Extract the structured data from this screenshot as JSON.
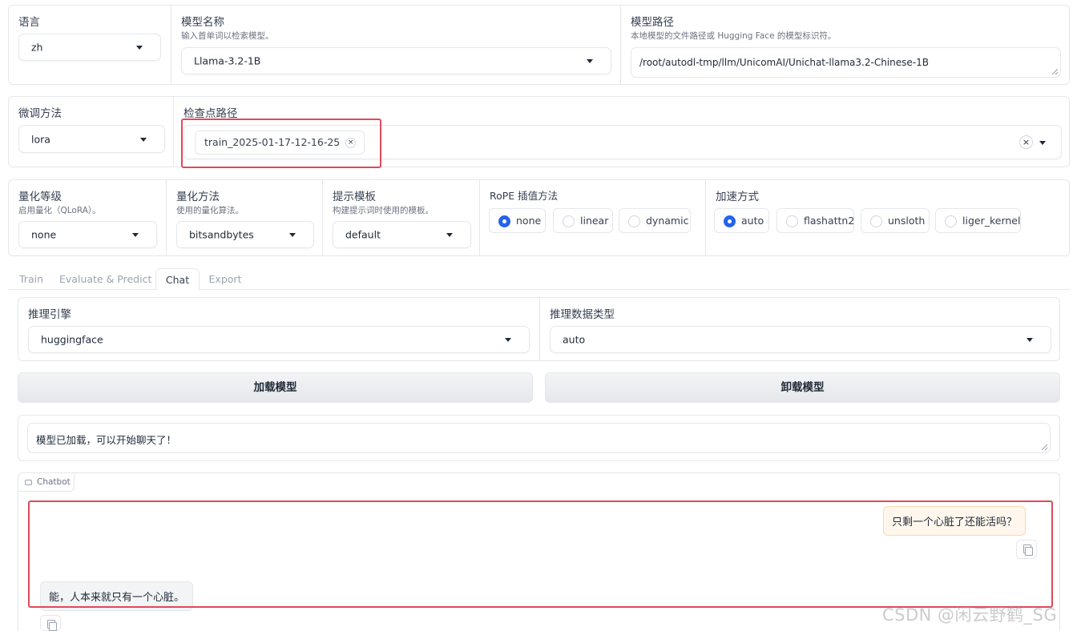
{
  "row1": {
    "language": {
      "label": "语言",
      "value": "zh"
    },
    "model_name": {
      "label": "模型名称",
      "info": "输入首单词以检索模型。",
      "value": "Llama-3.2-1B"
    },
    "model_path": {
      "label": "模型路径",
      "info": "本地模型的文件路径或 Hugging Face 的模型标识符。",
      "value": "/root/autodl-tmp/llm/UnicomAI/Unichat-llama3.2-Chinese-1B"
    }
  },
  "row2": {
    "finetune": {
      "label": "微调方法",
      "value": "lora"
    },
    "checkpoint": {
      "label": "检查点路径",
      "chips": [
        "train_2025-01-17-12-16-25"
      ],
      "clear_symbol": "×",
      "chip_remove_symbol": "×"
    }
  },
  "row3": {
    "quant_bit": {
      "label": "量化等级",
      "info": "启用量化（QLoRA）。",
      "value": "none"
    },
    "quant_method": {
      "label": "量化方法",
      "info": "使用的量化算法。",
      "value": "bitsandbytes"
    },
    "template": {
      "label": "提示模板",
      "info": "构建提示词时使用的模板。",
      "value": "default"
    },
    "rope": {
      "label": "RoPE 插值方法",
      "options": [
        "none",
        "linear",
        "dynamic"
      ],
      "selected": "none"
    },
    "booster": {
      "label": "加速方式",
      "options": [
        "auto",
        "flashattn2",
        "unsloth",
        "liger_kernel"
      ],
      "selected": "auto"
    }
  },
  "tabs": [
    "Train",
    "Evaluate & Predict",
    "Chat",
    "Export"
  ],
  "active_tab": "Chat",
  "chat": {
    "infer_backend": {
      "label": "推理引擎",
      "value": "huggingface"
    },
    "infer_dtype": {
      "label": "推理数据类型",
      "value": "auto"
    },
    "load_button": "加载模型",
    "unload_button": "卸载模型",
    "info_box": "模型已加载，可以开始聊天了！",
    "chatbot_label": "Chatbot",
    "messages": [
      {
        "role": "user",
        "text": "只剩一个心脏了还能活吗？"
      },
      {
        "role": "assistant",
        "text": "能，人本来就只有一个心脏。"
      }
    ]
  },
  "watermark": "CSDN @闲云野鹤_SG",
  "colors": {
    "accent": "#2563eb",
    "highlight": "#e0495a",
    "user_bubble": "#fff7ed",
    "bot_bubble": "#f3f4f6"
  }
}
